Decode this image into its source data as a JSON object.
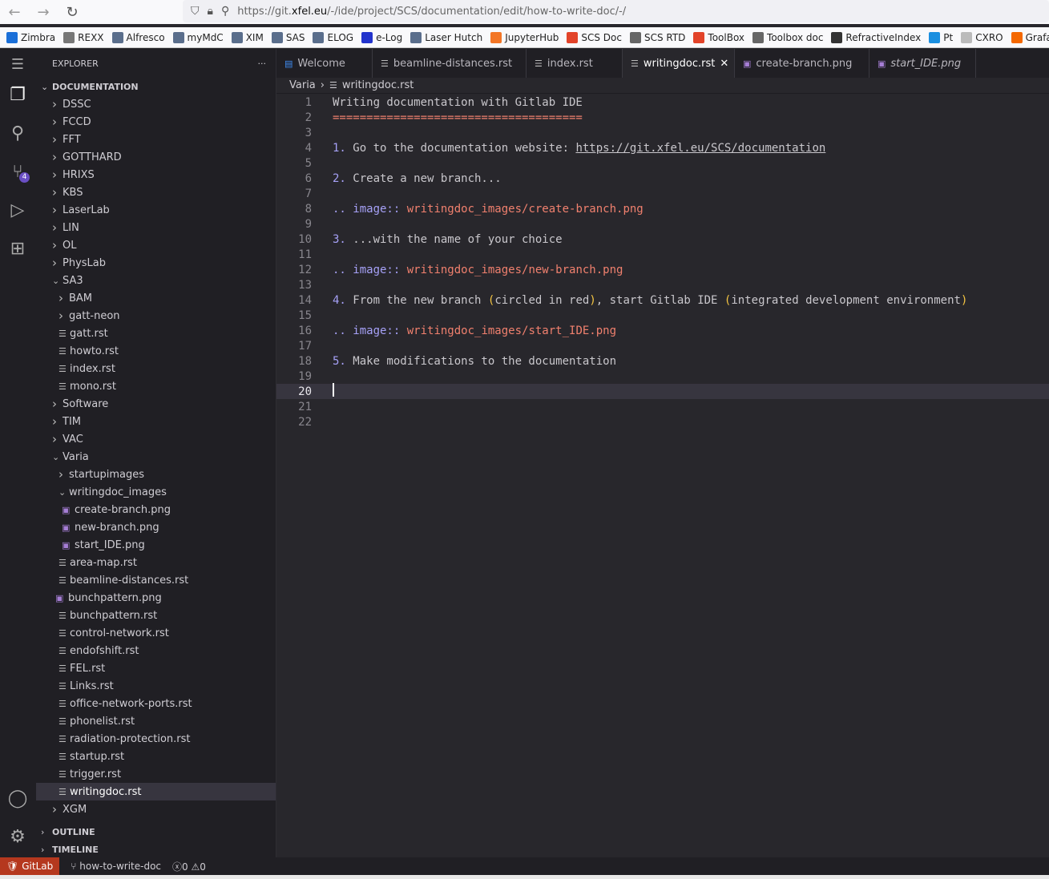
{
  "browser": {
    "url_prefix": "https://git.",
    "url_domain": "xfel.eu",
    "url_rest": "/-/ide/project/SCS/documentation/edit/how-to-write-doc/-/",
    "bookmarks": [
      {
        "label": "Zimbra",
        "color": "#1a6fd8"
      },
      {
        "label": "REXX",
        "color": "#777"
      },
      {
        "label": "Alfresco",
        "color": "#5a6e8c"
      },
      {
        "label": "myMdC",
        "color": "#5a6e8c"
      },
      {
        "label": "XIM",
        "color": "#5a6e8c"
      },
      {
        "label": "SAS",
        "color": "#5a6e8c"
      },
      {
        "label": "ELOG",
        "color": "#5a6e8c"
      },
      {
        "label": "e-Log",
        "color": "#2233cc"
      },
      {
        "label": "Laser Hutch",
        "color": "#5a6e8c"
      },
      {
        "label": "JupyterHub",
        "color": "#f37626"
      },
      {
        "label": "SCS Doc",
        "color": "#e24329"
      },
      {
        "label": "SCS RTD",
        "color": "#666"
      },
      {
        "label": "ToolBox",
        "color": "#e24329"
      },
      {
        "label": "Toolbox doc",
        "color": "#666"
      },
      {
        "label": "RefractiveIndex",
        "color": "#333"
      },
      {
        "label": "Pt",
        "color": "#1a8fe0"
      },
      {
        "label": "CXRO",
        "color": "#bbb"
      },
      {
        "label": "Grafana",
        "color": "#f46800"
      }
    ]
  },
  "sidebar": {
    "title": "EXPLORER",
    "more": "···",
    "root": "DOCUMENTATION",
    "scm_badge": "4",
    "tree": [
      {
        "l": 1,
        "t": "dir",
        "n": "DSSC"
      },
      {
        "l": 1,
        "t": "dir",
        "n": "FCCD"
      },
      {
        "l": 1,
        "t": "dir",
        "n": "FFT"
      },
      {
        "l": 1,
        "t": "dir",
        "n": "GOTTHARD"
      },
      {
        "l": 1,
        "t": "dir",
        "n": "HRIXS"
      },
      {
        "l": 1,
        "t": "dir",
        "n": "KBS"
      },
      {
        "l": 1,
        "t": "dir",
        "n": "LaserLab"
      },
      {
        "l": 1,
        "t": "dir",
        "n": "LIN"
      },
      {
        "l": 1,
        "t": "dir",
        "n": "OL"
      },
      {
        "l": 1,
        "t": "dir",
        "n": "PhysLab"
      },
      {
        "l": 1,
        "t": "open",
        "n": "SA3"
      },
      {
        "l": 2,
        "t": "dir",
        "n": "BAM"
      },
      {
        "l": 2,
        "t": "dir",
        "n": "gatt-neon"
      },
      {
        "l": 2,
        "t": "file",
        "n": "gatt.rst"
      },
      {
        "l": 2,
        "t": "file",
        "n": "howto.rst"
      },
      {
        "l": 2,
        "t": "file",
        "n": "index.rst"
      },
      {
        "l": 2,
        "t": "file",
        "n": "mono.rst"
      },
      {
        "l": 1,
        "t": "dir",
        "n": "Software"
      },
      {
        "l": 1,
        "t": "dir",
        "n": "TIM"
      },
      {
        "l": 1,
        "t": "dir",
        "n": "VAC"
      },
      {
        "l": 1,
        "t": "open",
        "n": "Varia"
      },
      {
        "l": 2,
        "t": "dir",
        "n": "startupimages"
      },
      {
        "l": 2,
        "t": "open",
        "n": "writingdoc_images"
      },
      {
        "l": 3,
        "t": "img",
        "n": "create-branch.png"
      },
      {
        "l": 3,
        "t": "img",
        "n": "new-branch.png"
      },
      {
        "l": 3,
        "t": "img",
        "n": "start_IDE.png"
      },
      {
        "l": 2,
        "t": "file",
        "n": "area-map.rst"
      },
      {
        "l": 2,
        "t": "file",
        "n": "beamline-distances.rst"
      },
      {
        "l": 2,
        "t": "img",
        "n": "bunchpattern.png"
      },
      {
        "l": 2,
        "t": "file",
        "n": "bunchpattern.rst"
      },
      {
        "l": 2,
        "t": "file",
        "n": "control-network.rst"
      },
      {
        "l": 2,
        "t": "file",
        "n": "endofshift.rst"
      },
      {
        "l": 2,
        "t": "file",
        "n": "FEL.rst"
      },
      {
        "l": 2,
        "t": "file",
        "n": "Links.rst"
      },
      {
        "l": 2,
        "t": "file",
        "n": "office-network-ports.rst"
      },
      {
        "l": 2,
        "t": "file",
        "n": "phonelist.rst"
      },
      {
        "l": 2,
        "t": "file",
        "n": "radiation-protection.rst"
      },
      {
        "l": 2,
        "t": "file",
        "n": "startup.rst"
      },
      {
        "l": 2,
        "t": "file",
        "n": "trigger.rst"
      },
      {
        "l": 2,
        "t": "file",
        "n": "writingdoc.rst",
        "sel": true
      },
      {
        "l": 1,
        "t": "dir",
        "n": "XGM"
      }
    ],
    "outline": "OUTLINE",
    "timeline": "TIMELINE"
  },
  "tabs": [
    {
      "label": "Welcome",
      "icon": "w"
    },
    {
      "label": "beamline-distances.rst",
      "icon": "file"
    },
    {
      "label": "index.rst",
      "icon": "file"
    },
    {
      "label": "writingdoc.rst",
      "icon": "file",
      "active": true,
      "close": "✕"
    },
    {
      "label": "create-branch.png",
      "icon": "img"
    },
    {
      "label": "start_IDE.png",
      "icon": "img",
      "italic": true
    }
  ],
  "breadcrumb": {
    "folder": "Varia",
    "file": "writingdoc.rst"
  },
  "editor": {
    "current_line": 20,
    "lines": [
      [
        [
          "text",
          "Writing documentation with Gitlab IDE"
        ]
      ],
      [
        [
          "eq",
          "====================================="
        ]
      ],
      [],
      [
        [
          "num",
          "1."
        ],
        [
          "text",
          " Go to the documentation website: "
        ],
        [
          "link",
          "https://git.xfel.eu/SCS/documentation"
        ]
      ],
      [],
      [
        [
          "num",
          "2."
        ],
        [
          "text",
          " Create a new branch..."
        ]
      ],
      [],
      [
        [
          "dir",
          ".. image::"
        ],
        [
          "text",
          " "
        ],
        [
          "path",
          "writingdoc_images/create-branch.png"
        ]
      ],
      [],
      [
        [
          "num",
          "3."
        ],
        [
          "text",
          " ...with the name of your choice"
        ]
      ],
      [],
      [
        [
          "dir",
          ".. image::"
        ],
        [
          "text",
          " "
        ],
        [
          "path",
          "writingdoc_images/new-branch.png"
        ]
      ],
      [],
      [
        [
          "num",
          "4."
        ],
        [
          "text",
          " From the new branch "
        ],
        [
          "paren",
          "("
        ],
        [
          "text",
          "circled in red"
        ],
        [
          "paren",
          ")"
        ],
        [
          "text",
          ", start Gitlab IDE "
        ],
        [
          "paren",
          "("
        ],
        [
          "text",
          "integrated development environment"
        ],
        [
          "paren",
          ")"
        ]
      ],
      [],
      [
        [
          "dir",
          ".. image::"
        ],
        [
          "text",
          " "
        ],
        [
          "path",
          "writingdoc_images/start_IDE.png"
        ]
      ],
      [],
      [
        [
          "num",
          "5."
        ],
        [
          "text",
          " Make modifications to the documentation"
        ]
      ],
      [],
      [],
      [],
      []
    ]
  },
  "status": {
    "gitlab": "GitLab",
    "branch": "how-to-write-doc",
    "errors": "0",
    "warnings": "0"
  }
}
